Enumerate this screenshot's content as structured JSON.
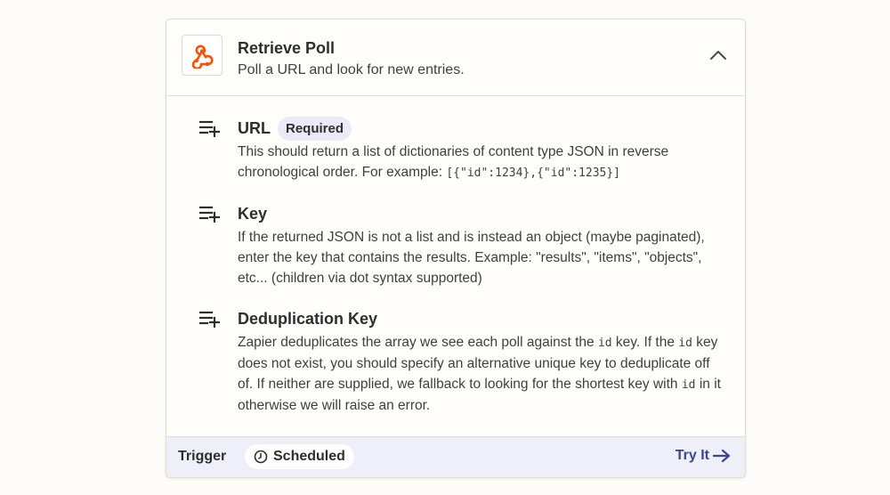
{
  "header": {
    "title": "Retrieve Poll",
    "subtitle": "Poll a URL and look for new entries."
  },
  "fields": {
    "url": {
      "name": "URL",
      "badge": "Required",
      "desc_1": "This should return a list of dictionaries of content type JSON in reverse chronological order. For example: ",
      "example_code": "[{\"id\":1234},{\"id\":1235}]"
    },
    "key": {
      "name": "Key",
      "desc": "If the returned JSON is not a list and is instead an object (maybe paginated), enter the key that contains the results. Example: \"results\", \"items\", \"objects\", etc... (children via dot syntax supported)"
    },
    "dedup": {
      "name": "Deduplication Key",
      "desc_1": "Zapier deduplicates the array we see each poll against the ",
      "code_1": "id",
      "desc_2": " key. If the ",
      "code_2": "id",
      "desc_3": " key does not exist, you should specify an alternative unique key to deduplicate off of. If neither are supplied, we fallback to looking for the shortest key with ",
      "code_3": "id",
      "desc_4": " in it otherwise we will raise an error."
    }
  },
  "footer": {
    "trigger_label": "Trigger",
    "schedule_label": "Scheduled",
    "try_label": "Try It"
  },
  "icons": {
    "app": "webhook-icon",
    "collapse": "chevron-up-icon",
    "field": "playlist-add-icon",
    "schedule": "clock-icon",
    "try": "arrow-right-icon"
  },
  "colors": {
    "brand": "#ff4f00",
    "link": "#3d4592",
    "footer_bg": "#eeeff8",
    "badge_bg": "#ebeaf9"
  }
}
